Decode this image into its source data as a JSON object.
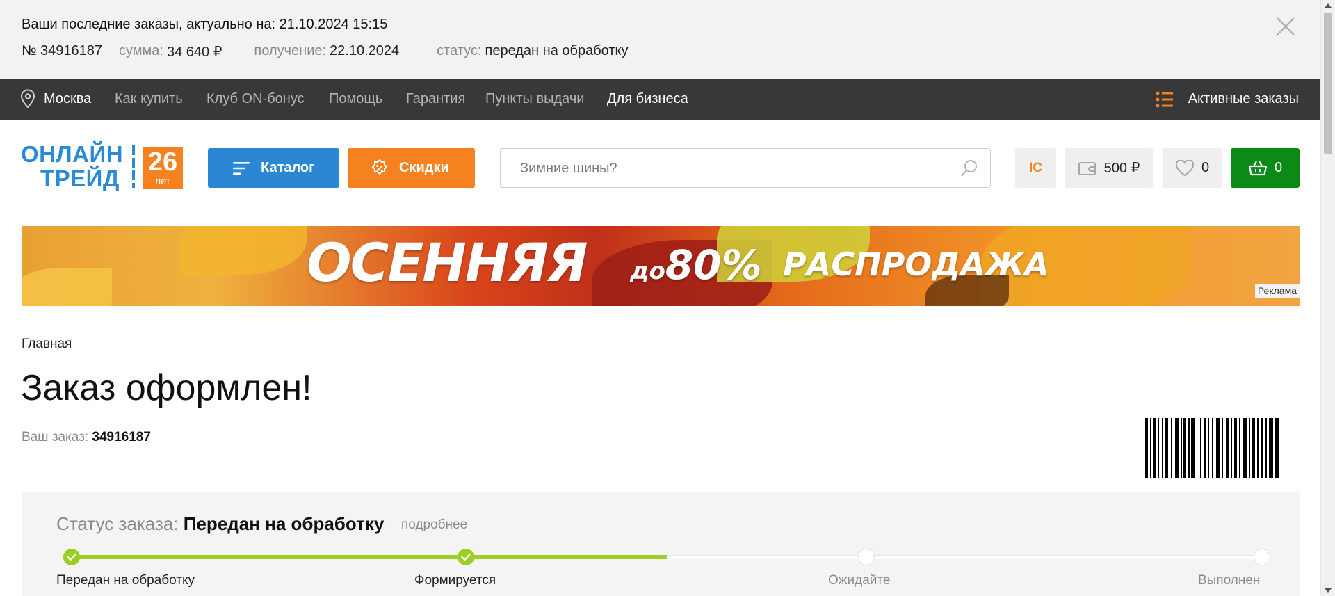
{
  "order_bar": {
    "title": "Ваши последние заказы, актуально на: 21.10.2024 15:15",
    "number": "№ 34916187",
    "sum_label": "сумма:",
    "sum_value": "34 640 ₽",
    "receive_label": "получение:",
    "receive_value": "22.10.2024",
    "status_label": "статус:",
    "status_value": "передан на обработку"
  },
  "top_nav": {
    "city": "Москва",
    "links": [
      "Как купить",
      "Клуб ON-бонус",
      "Помощь",
      "Гарантия",
      "Пункты выдачи"
    ],
    "business": "Для бизнеса",
    "active_orders": "Активные заказы"
  },
  "header": {
    "logo_line1": "ОНЛАЙН",
    "logo_line2": "ТРЕЙД",
    "logo_years": "26",
    "logo_years_suffix": "лет",
    "catalog_label": "Каталог",
    "sale_label": "Скидки",
    "search_placeholder": "Зимние шины?",
    "ic_label": "IC",
    "wallet_value": "500 ₽",
    "favorites_count": "0",
    "cart_count": "0"
  },
  "banner": {
    "text1": "ОСЕННЯЯ",
    "text2_prefix": "до",
    "text2": "80%",
    "text3": "РАСПРОДАЖА",
    "ad_label": "Реклама"
  },
  "breadcrumb": "Главная",
  "page_title": "Заказ оформлен!",
  "order": {
    "label": "Ваш заказ:",
    "number": "34916187"
  },
  "status_panel": {
    "label": "Статус заказа:",
    "value": "Передан на обработку",
    "more": "подробнее",
    "progress": 0.5,
    "steps": [
      {
        "label": "Передан на обработку",
        "done": true
      },
      {
        "label": "Формируется",
        "done": true
      },
      {
        "label": "Ожидайте",
        "done": false
      },
      {
        "label": "Выполнен",
        "done": false
      }
    ]
  },
  "colors": {
    "accent_blue": "#2b87d3",
    "accent_orange": "#f5821f",
    "cart_green": "#0b8a17",
    "progress_green": "#9ccf25",
    "nav_bg": "#383838"
  }
}
